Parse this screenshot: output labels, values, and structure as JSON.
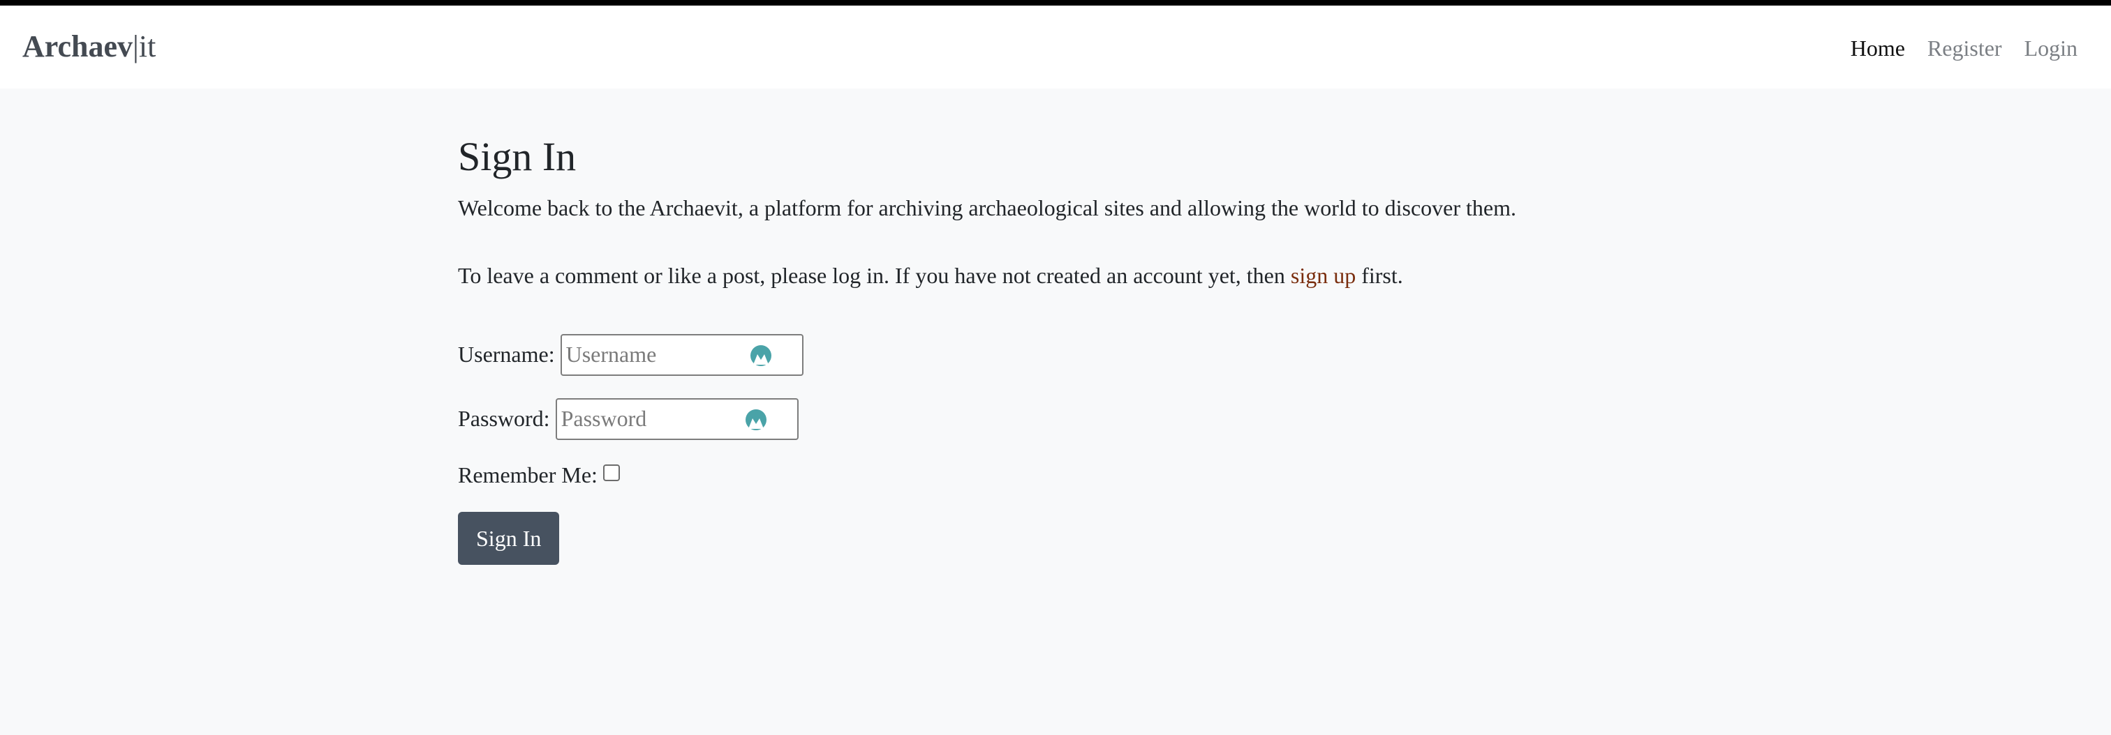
{
  "brand": {
    "part1": "Archaev",
    "separator": "|",
    "part2": "it"
  },
  "nav": {
    "home": "Home",
    "register": "Register",
    "login": "Login"
  },
  "page": {
    "title": "Sign In",
    "welcome": "Welcome back to the Archaevit, a platform for archiving archaeological sites and allowing the world to discover them.",
    "intro_before": "To leave a comment or like a post, please log in. If you have not created an account yet, then ",
    "signup_link": "sign up",
    "intro_after": " first."
  },
  "form": {
    "username_label": "Username:",
    "username_placeholder": "Username",
    "username_value": "",
    "password_label": "Password:",
    "password_placeholder": "Password",
    "password_value": "",
    "remember_label": "Remember Me:",
    "remember_checked": false,
    "submit_label": "Sign In"
  },
  "icons": {
    "field_icon": "password-manager-icon"
  },
  "colors": {
    "topbar": "#000000",
    "navbar_bg": "#ffffff",
    "page_bg": "#f8f9fa",
    "link": "#7a2e0e",
    "button_bg": "#475260",
    "field_icon": "#4aa3a8"
  }
}
